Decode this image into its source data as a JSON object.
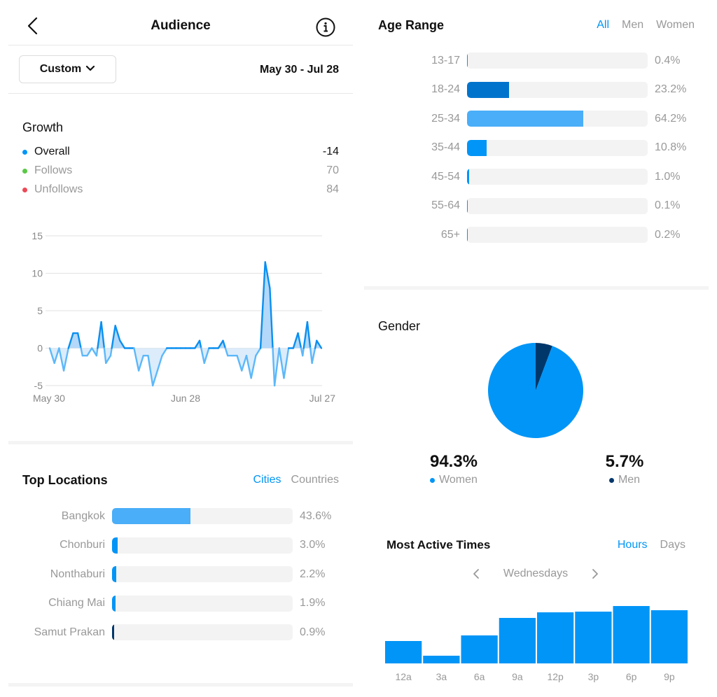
{
  "header": {
    "title": "Audience",
    "back_icon": "chevron-left-icon",
    "info_icon": "info-circle-icon"
  },
  "filter": {
    "period_label": "Custom",
    "period_icon": "chevron-down-icon",
    "date_range": "May 30 - Jul 28"
  },
  "growth": {
    "title": "Growth",
    "legend": [
      {
        "label": "Overall",
        "value": "-14",
        "color": "#0095f6"
      },
      {
        "label": "Follows",
        "value": "70",
        "color": "#5ac846"
      },
      {
        "label": "Unfollows",
        "value": "84",
        "color": "#ed4956"
      }
    ]
  },
  "top_locations": {
    "title": "Top Locations",
    "tabs": [
      {
        "label": "Cities",
        "active": true
      },
      {
        "label": "Countries",
        "active": false
      }
    ],
    "items": [
      {
        "label": "Bangkok",
        "pct_label": "43.6%",
        "value": 43.6,
        "color": "#4aaef8"
      },
      {
        "label": "Chonburi",
        "pct_label": "3.0%",
        "value": 3.0,
        "color": "#0095f6"
      },
      {
        "label": "Nonthaburi",
        "pct_label": "2.2%",
        "value": 2.2,
        "color": "#0095f6"
      },
      {
        "label": "Chiang Mai",
        "pct_label": "1.9%",
        "value": 1.9,
        "color": "#0095f6"
      },
      {
        "label": "Samut Prakan",
        "pct_label": "0.9%",
        "value": 0.9,
        "color": "#00376b"
      }
    ]
  },
  "age_range": {
    "title": "Age Range",
    "tabs": [
      {
        "label": "All",
        "active": true
      },
      {
        "label": "Men",
        "active": false
      },
      {
        "label": "Women",
        "active": false
      }
    ],
    "items": [
      {
        "label": "13-17",
        "pct_label": "0.4%",
        "value": 0.4,
        "color": "#0095f6"
      },
      {
        "label": "18-24",
        "pct_label": "23.2%",
        "value": 23.2,
        "color": "#0074cc"
      },
      {
        "label": "25-34",
        "pct_label": "64.2%",
        "value": 64.2,
        "color": "#4aaef8"
      },
      {
        "label": "35-44",
        "pct_label": "10.8%",
        "value": 10.8,
        "color": "#0095f6"
      },
      {
        "label": "45-54",
        "pct_label": "1.0%",
        "value": 1.0,
        "color": "#0095f6"
      },
      {
        "label": "55-64",
        "pct_label": "0.1%",
        "value": 0.1,
        "color": "#0095f6"
      },
      {
        "label": "65+",
        "pct_label": "0.2%",
        "value": 0.2,
        "color": "#0095f6"
      }
    ]
  },
  "gender": {
    "title": "Gender",
    "women": {
      "pct_label": "94.3%",
      "label": "Women",
      "color": "#0095f6"
    },
    "men": {
      "pct_label": "5.7%",
      "label": "Men",
      "color": "#00376b"
    }
  },
  "most_active": {
    "title": "Most Active Times",
    "tabs": [
      {
        "label": "Hours",
        "active": true
      },
      {
        "label": "Days",
        "active": false
      }
    ],
    "day_label": "Wednesdays",
    "prev_icon": "chevron-left-icon",
    "next_icon": "chevron-right-icon"
  },
  "chart_data": [
    {
      "type": "area",
      "title": "Growth",
      "x_ticks": [
        "May 30",
        "Jun 28",
        "Jul 27"
      ],
      "y_ticks": [
        15,
        10,
        5,
        0,
        -5
      ],
      "ylim": [
        -5,
        15
      ],
      "grid": true,
      "series": [
        {
          "name": "Overall",
          "values": [
            0,
            -2,
            0,
            -3,
            0,
            2,
            2,
            -1,
            -1,
            0,
            -1,
            3.5,
            -2,
            -1,
            3,
            1,
            0,
            0,
            0,
            -3,
            -1,
            -1,
            -5,
            -3,
            -1,
            0,
            0,
            0,
            0,
            0,
            0,
            0,
            1,
            -2,
            0,
            0,
            0,
            1,
            -1,
            -1,
            -1,
            -3,
            -1,
            -4,
            -1,
            0,
            11.5,
            8,
            -5,
            0,
            -4,
            0,
            0,
            2,
            -1,
            3.5,
            -2,
            1,
            0
          ]
        }
      ]
    },
    {
      "type": "pie",
      "title": "Gender",
      "categories": [
        "Women",
        "Men"
      ],
      "values": [
        94.3,
        5.7
      ]
    },
    {
      "type": "bar",
      "title": "Most Active Times",
      "categories": [
        "12a",
        "3a",
        "6a",
        "9a",
        "12p",
        "3p",
        "6p",
        "9p"
      ],
      "values": [
        32,
        11,
        40,
        65,
        73,
        74,
        82,
        76
      ],
      "ylim": [
        0,
        100
      ]
    }
  ]
}
